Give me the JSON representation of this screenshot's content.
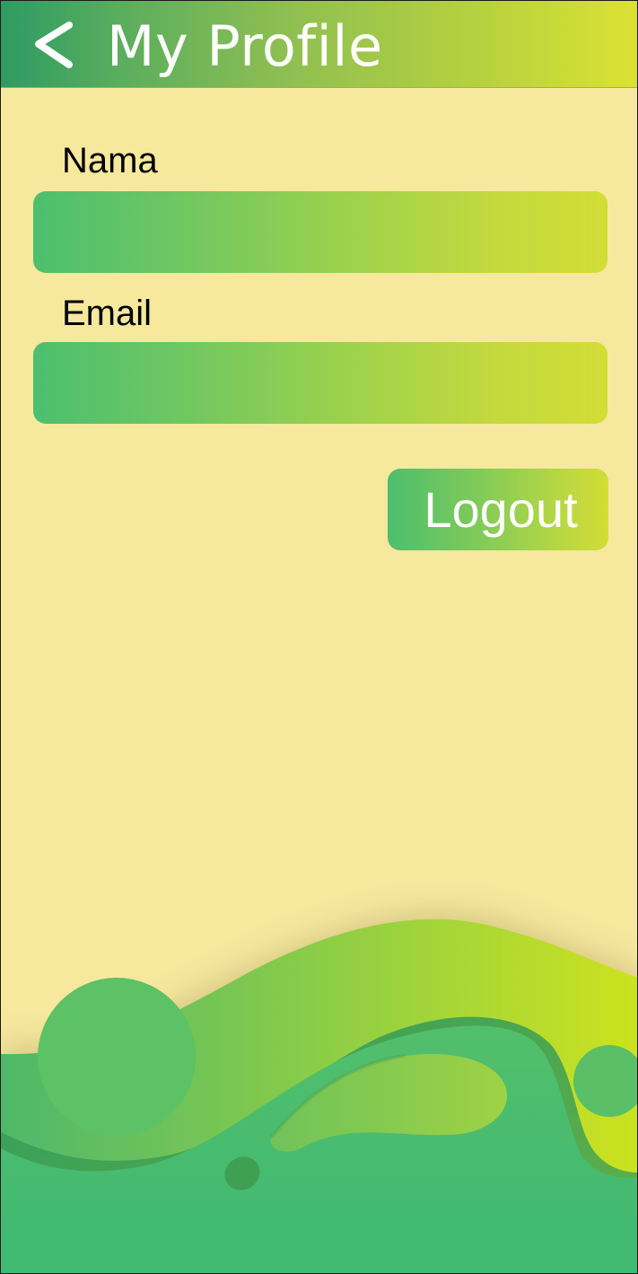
{
  "header": {
    "back_icon": "chevron-left-icon",
    "title": "My Profile"
  },
  "form": {
    "nama_label": "Nama",
    "nama_value": "",
    "email_label": "Email",
    "email_value": ""
  },
  "actions": {
    "logout_label": "Logout"
  },
  "colors": {
    "background": "#f6e89d",
    "accent_green": "#45bc6f",
    "accent_yellow": "#d8e231",
    "text_white": "#ffffff"
  }
}
